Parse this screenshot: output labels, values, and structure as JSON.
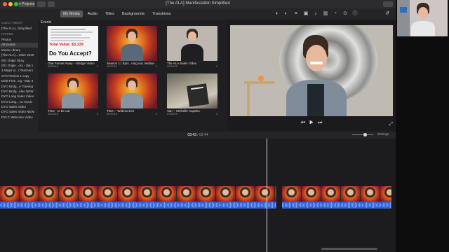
{
  "window": {
    "projects_label": "< Projects",
    "title": "[The ALA] Manifestation Simplified"
  },
  "toolbar": {
    "tabs": [
      "My Media",
      "Audio",
      "Titles",
      "Backgrounds",
      "Transitions"
    ],
    "active_tab": "My Media"
  },
  "sidebar": {
    "project_header": "OJECT MEDIA",
    "project_item": "[The ALA]...Simplified",
    "libraries_header": "RARIES",
    "items": [
      "Photos",
      "All Events",
      "Movie Library",
      "[The ALA]....mber 2019",
      "001 Origin Story",
      "001 Origin...ory - clip 1",
      "3 Steps to...r Teachers",
      "CFS Review 1 copy",
      "Debt-Free...ng - May 3",
      "DYO Bridg...e Training",
      "DYO Bridg...ideo NEW",
      "DYO Long Sales Video",
      "DYO Long... no music",
      "DYO Sales Video",
      "DYO Sales Video NEW",
      "DYLC Welcome Video"
    ],
    "selected": "All Events"
  },
  "browser": {
    "header": "Events",
    "clips": [
      {
        "label": "One Funnel Away -- Bridge Video",
        "date": "08/03/19",
        "count": "1",
        "type": "doc"
      },
      {
        "label": "Season 1 | Epis...ning out, lesbian",
        "date": "10/07/19",
        "count": "1",
        "type": "mandala"
      },
      {
        "label": "The ALA Sales Video",
        "date": "12/13/19",
        "count": "1",
        "type": "plain"
      },
      {
        "label": "Time - to be out",
        "date": "04/10/19",
        "count": "1",
        "type": "mandala"
      },
      {
        "label": "Time -- Widescreen",
        "date": "09/10/19",
        "count": "1",
        "type": "mandala"
      },
      {
        "label": "Van -- Michelle Capdeu",
        "date": "07/03/19",
        "count": "1",
        "type": "car"
      }
    ],
    "doc_text": {
      "total_value": "Total Value: $3,129",
      "question": "Do You Accept?"
    }
  },
  "viewer": {
    "controls": [
      "⏮",
      "▶",
      "⏭"
    ]
  },
  "timeline": {
    "current_time": "03:43",
    "duration": "02:44",
    "settings_label": "Settings"
  }
}
